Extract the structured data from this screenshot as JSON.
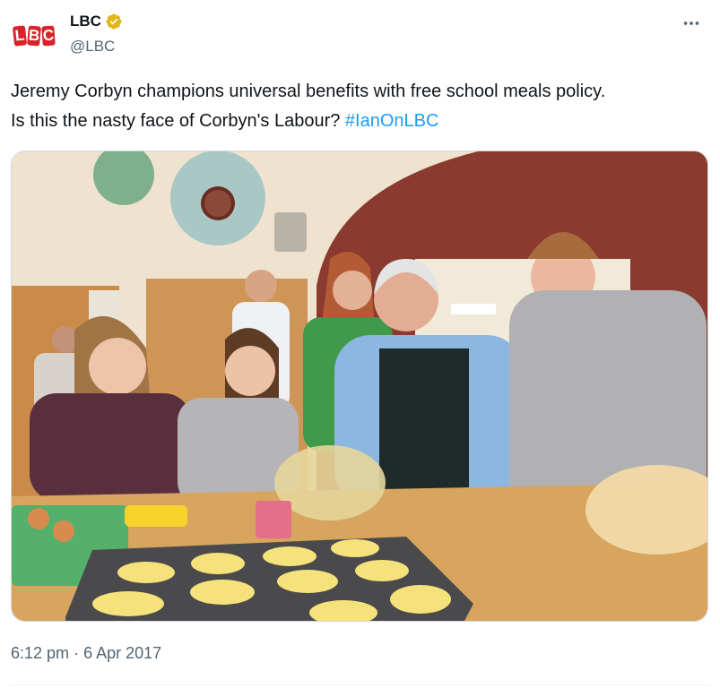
{
  "account": {
    "display_name": "LBC",
    "handle": "@LBC",
    "verified": true,
    "verified_color": "#e2b719",
    "logo_letters": [
      "L",
      "B",
      "C"
    ],
    "logo_color": "#d8232a"
  },
  "tweet": {
    "text_line1": "Jeremy Corbyn champions universal benefits with free school meals policy.",
    "text_line2": "Is this the nasty face of Corbyn's Labour?",
    "hashtag": "#IanOnLBC",
    "hashtag_color": "#1d9bf0",
    "time": "6:12 pm",
    "separator": "·",
    "date": "6 Apr 2017"
  },
  "icons": {
    "more": "more-horizontal-icon",
    "verified": "verified-badge-icon"
  }
}
